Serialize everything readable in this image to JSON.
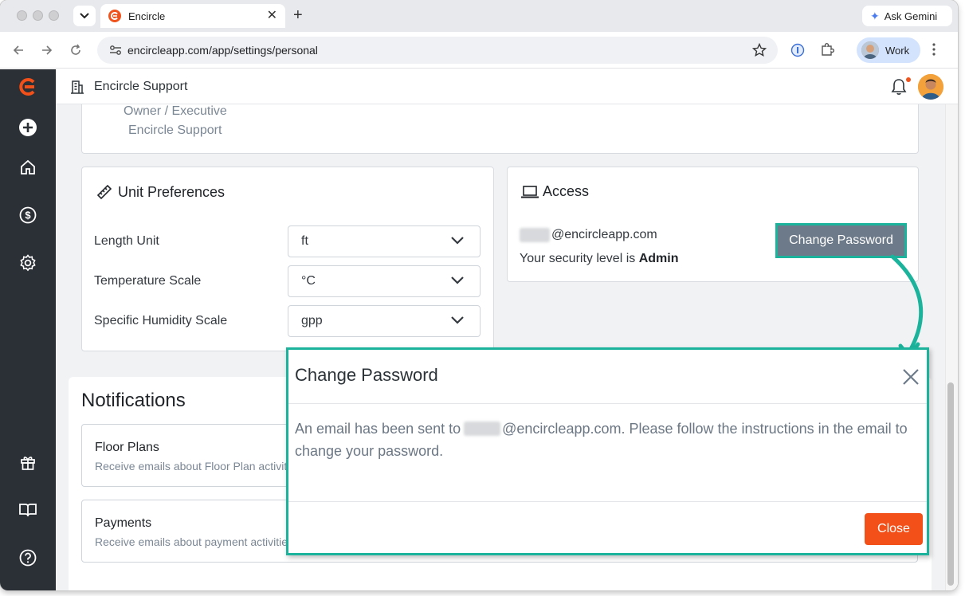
{
  "browser": {
    "tab_title": "Encircle",
    "gemini_label": "Ask Gemini",
    "url": "encircleapp.com/app/settings/personal",
    "profile_label": "Work"
  },
  "app": {
    "org_name": "Encircle Support",
    "sidebar_icons": [
      "encircle-logo-icon",
      "plus-icon",
      "home-icon",
      "dollar-icon",
      "settings-gear-icon",
      "gift-icon",
      "book-icon",
      "help-icon"
    ]
  },
  "profile_card": {
    "role": "Owner / Executive",
    "organization": "Encircle Support"
  },
  "unit_preferences": {
    "title": "Unit Preferences",
    "fields": [
      {
        "label": "Length Unit",
        "value": "ft"
      },
      {
        "label": "Temperature Scale",
        "value": "°C"
      },
      {
        "label": "Specific Humidity Scale",
        "value": "gpp"
      }
    ]
  },
  "access": {
    "title": "Access",
    "email_domain": "@encircleapp.com",
    "security_prefix": "Your security level is ",
    "security_level": "Admin",
    "change_password_label": "Change Password"
  },
  "notifications": {
    "heading": "Notifications",
    "items": [
      {
        "title": "Floor Plans",
        "description": "Receive emails about Floor Plan activities"
      },
      {
        "title": "Payments",
        "description": "Receive emails about payment activities"
      }
    ]
  },
  "modal": {
    "title": "Change Password",
    "body_prefix": "An email has been sent to",
    "body_suffix": "@encircleapp.com. Please follow the instructions in the email to change your password.",
    "close_label": "Close"
  },
  "colors": {
    "brand_orange": "#f25018",
    "highlight_teal": "#1bb39b",
    "sidebar_bg": "#2b2f36"
  }
}
